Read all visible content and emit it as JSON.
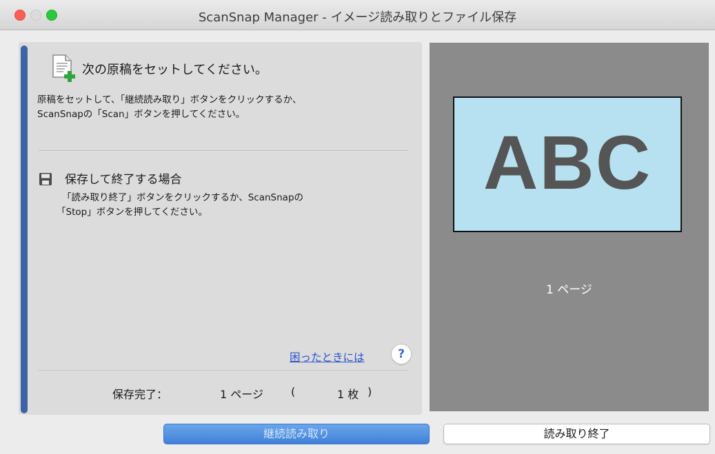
{
  "window": {
    "title": "ScanSnap Manager - イメージ読み取りとファイル保存"
  },
  "left": {
    "heading": "次の原稿をセットしてください。",
    "description_line1": "原稿をセットして、「継続読み取り」ボタンをクリックするか、",
    "description_line2": "ScanSnapの「Scan」ボタンを押してください。",
    "save_heading": "保存して終了する場合",
    "save_description_line1": "「読み取り終了」ボタンをクリックするか、ScanSnapの",
    "save_description_line2": "「Stop」ボタンを押してください。",
    "help_link": "困ったときには",
    "help_button": "?",
    "status": {
      "label": "保存完了：",
      "pages": "1 ページ",
      "open_paren": "(",
      "sheets": "1 枚",
      "close_paren": ")"
    }
  },
  "preview": {
    "page_text": "ABC",
    "page_count": "1 ページ"
  },
  "buttons": {
    "continue": "継続読み取り",
    "finish": "読み取り終了"
  },
  "colors": {
    "accent_bar": "#3f63a7",
    "primary_button": "#3f81d8",
    "preview_bg": "#8b8b8b",
    "preview_page": "#b7e1f0",
    "link": "#2a53c8"
  },
  "icons": {
    "document": "document-add-icon",
    "save": "floppy-disk-icon"
  }
}
